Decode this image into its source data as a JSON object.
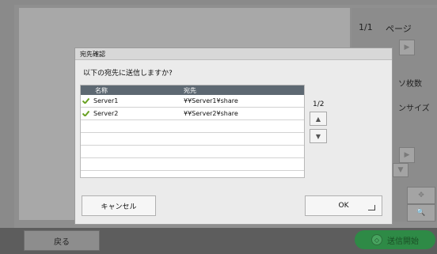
{
  "background": {
    "page_number": "1/1",
    "page_label": "ページ",
    "sheets_label": "ソ枚数",
    "size_label": "ンサイズ",
    "back_label": "戻る",
    "start_label": "送信開始"
  },
  "dialog": {
    "title": "宛先確認",
    "question": "以下の宛先に送信しますか?",
    "columns": {
      "name": "名称",
      "destination": "宛先"
    },
    "rows": [
      {
        "name": "Server1",
        "destination": "¥¥Server1¥share",
        "checked": true
      },
      {
        "name": "Server2",
        "destination": "¥¥Server2¥share",
        "checked": true
      }
    ],
    "page_count": "1/2",
    "cancel_label": "キャンセル",
    "ok_label": "OK"
  },
  "colors": {
    "check": "#6aa224",
    "header": "#5d6872",
    "start_button": "#2e8a46"
  },
  "icons": [
    "check-icon",
    "scroll-up-icon",
    "scroll-down-icon",
    "enter-icon",
    "start-icon",
    "zoom-icon",
    "rotate-icon"
  ]
}
